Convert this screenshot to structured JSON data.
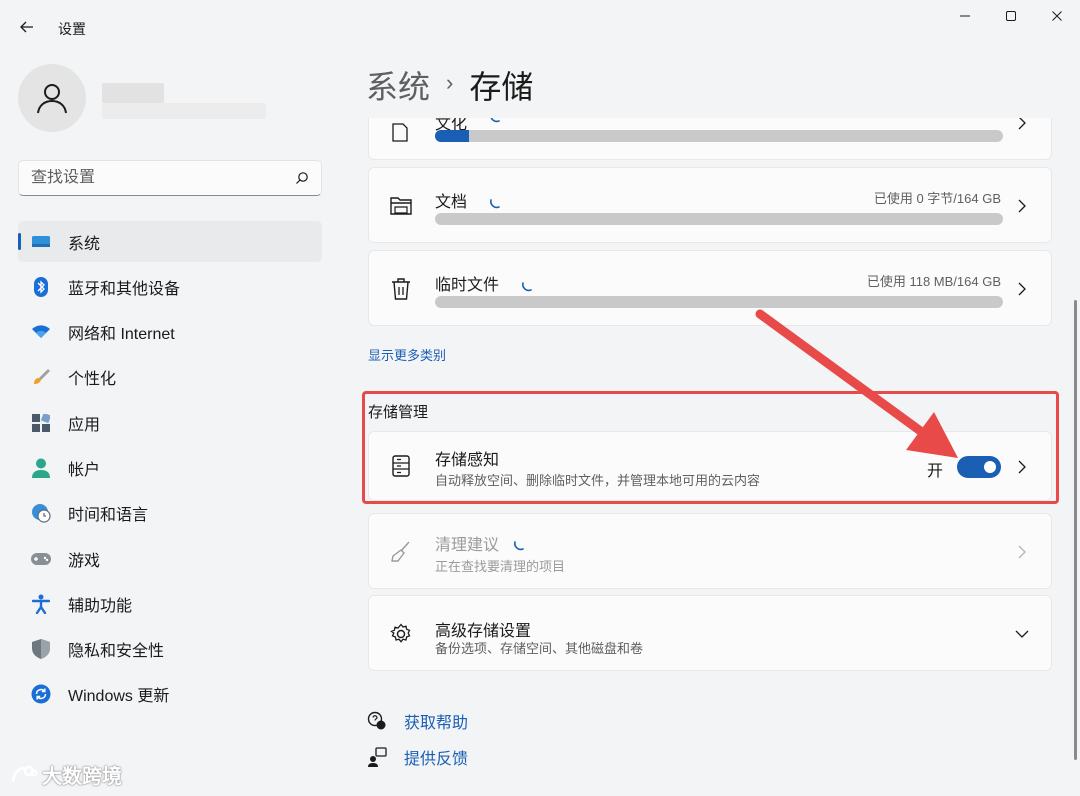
{
  "window": {
    "title": "设置"
  },
  "search": {
    "placeholder": "查找设置"
  },
  "nav": {
    "items": [
      {
        "label": "系统",
        "icon": "monitor-icon"
      },
      {
        "label": "蓝牙和其他设备",
        "icon": "bluetooth-icon"
      },
      {
        "label": "网络和 Internet",
        "icon": "wifi-icon"
      },
      {
        "label": "个性化",
        "icon": "brush-icon"
      },
      {
        "label": "应用",
        "icon": "apps-icon"
      },
      {
        "label": "帐户",
        "icon": "person-icon"
      },
      {
        "label": "时间和语言",
        "icon": "globe-clock-icon"
      },
      {
        "label": "游戏",
        "icon": "gamepad-icon"
      },
      {
        "label": "辅助功能",
        "icon": "accessibility-icon"
      },
      {
        "label": "隐私和安全性",
        "icon": "shield-icon"
      },
      {
        "label": "Windows 更新",
        "icon": "update-icon"
      }
    ],
    "active_index": 0
  },
  "breadcrumb": {
    "parent": "系统",
    "separator": "›",
    "current": "存储"
  },
  "storage": {
    "partial_card": {
      "title": "文化",
      "fill_fraction": 0.06
    },
    "documents": {
      "title": "文档",
      "usage": "已使用 0 字节/164 GB",
      "fill_fraction": 0.0
    },
    "temp_files": {
      "title": "临时文件",
      "usage": "已使用 118 MB/164 GB",
      "fill_fraction": 0.0
    },
    "show_more": "显示更多类别"
  },
  "management": {
    "section_title": "存储管理",
    "storage_sense": {
      "title": "存储感知",
      "subtitle": "自动释放空间、删除临时文件，并管理本地可用的云内容",
      "toggle_label": "开",
      "toggle_on": true
    },
    "cleanup": {
      "title": "清理建议",
      "subtitle": "正在查找要清理的项目"
    },
    "advanced": {
      "title": "高级存储设置",
      "subtitle": "备份选项、存储空间、其他磁盘和卷"
    }
  },
  "help": {
    "get_help": "获取帮助",
    "feedback": "提供反馈"
  },
  "watermark": "大数跨境",
  "colors": {
    "accent": "#1a5fb4",
    "highlight": "#e84a4a"
  }
}
